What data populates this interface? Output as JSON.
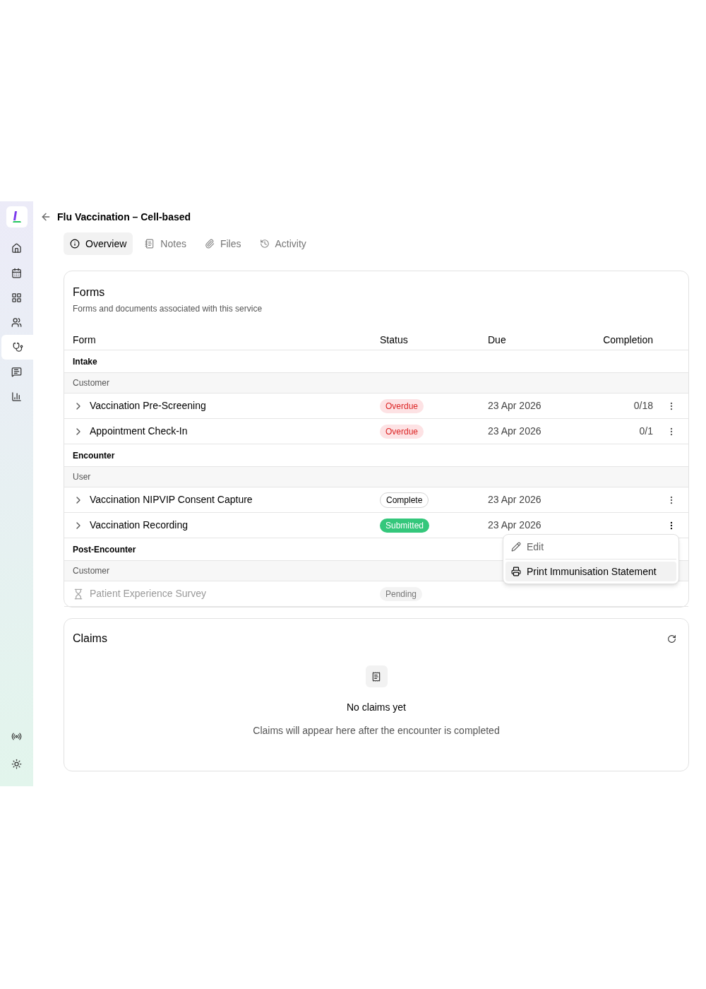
{
  "sidebar": {
    "items": [
      {
        "selected": false
      },
      {
        "selected": false
      },
      {
        "selected": false
      },
      {
        "selected": false
      },
      {
        "selected": true
      },
      {
        "selected": false
      },
      {
        "selected": false
      }
    ],
    "bottom_items": [
      {
        "selected": false
      },
      {
        "selected": false
      }
    ]
  },
  "header": {
    "title": "Flu Vaccination – Cell-based"
  },
  "tabs": [
    {
      "label": "Overview",
      "selected": true
    },
    {
      "label": "Notes",
      "selected": false
    },
    {
      "label": "Files",
      "selected": false
    },
    {
      "label": "Activity",
      "selected": false
    }
  ],
  "forms": {
    "title": "Forms",
    "subtitle": "Forms and documents associated with this service",
    "columns": [
      "Form",
      "Status",
      "Due",
      "Completion"
    ],
    "groups": [
      {
        "name": "Intake",
        "subgroups": [
          {
            "name": "Customer",
            "rows": [
              {
                "kind": "expandable",
                "name": "Vaccination Pre-Screening",
                "status": {
                  "label": "Overdue",
                  "kind": "overdue"
                },
                "due": "23 Apr 2026",
                "completion": "0/18",
                "menu_open": false
              },
              {
                "kind": "expandable",
                "name": "Appointment Check-In",
                "status": {
                  "label": "Overdue",
                  "kind": "overdue"
                },
                "due": "23 Apr 2026",
                "completion": "0/1",
                "menu_open": false
              }
            ]
          }
        ]
      },
      {
        "name": "Encounter",
        "subgroups": [
          {
            "name": "User",
            "rows": [
              {
                "kind": "expandable",
                "name": "Vaccination NIPVIP Consent Capture",
                "status": {
                  "label": "Complete",
                  "kind": "complete"
                },
                "due": "23 Apr 2026",
                "menu_open": false
              },
              {
                "kind": "expandable",
                "name": "Vaccination Recording",
                "status": {
                  "label": "Submitted",
                  "kind": "submitted"
                },
                "due": "23 Apr 2026",
                "menu_open": true
              }
            ]
          }
        ]
      },
      {
        "name": "Post-Encounter",
        "subgroups": [
          {
            "name": "Customer",
            "rows": [
              {
                "kind": "pending",
                "name": "Patient Experience Survey",
                "status": {
                  "label": "Pending",
                  "kind": "pending"
                }
              }
            ]
          }
        ]
      }
    ]
  },
  "row_menu": {
    "items": [
      {
        "label": "Edit",
        "kind": "edit",
        "selected": false
      },
      {
        "label": "Print Immunisation Statement",
        "kind": "print",
        "selected": true
      }
    ]
  },
  "claims": {
    "title": "Claims",
    "empty_title": "No claims yet",
    "empty_text": "Claims will appear here after the encounter is completed"
  }
}
